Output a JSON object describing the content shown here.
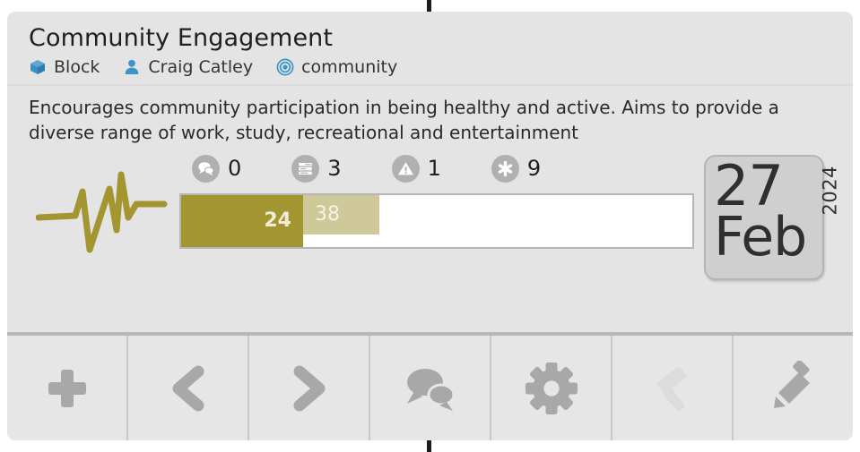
{
  "card": {
    "title": "Community Engagement",
    "meta": [
      {
        "icon": "cube-icon",
        "label": "Block"
      },
      {
        "icon": "user-icon",
        "label": "Craig Catley"
      },
      {
        "icon": "target-icon",
        "label": "community"
      }
    ],
    "description": "Encourages community participation in being healthy and active. Aims to provide a diverse range of work, study, recreational and entertainment",
    "stats": [
      {
        "icon": "comments-icon",
        "value": "0"
      },
      {
        "icon": "list-icon",
        "value": "3"
      },
      {
        "icon": "warning-icon",
        "value": "1"
      },
      {
        "icon": "asterisk-icon",
        "value": "9"
      }
    ],
    "progress": {
      "primary_value": "24",
      "secondary_value": "38"
    },
    "date": {
      "day": "27",
      "month": "Feb",
      "year": "2024"
    }
  },
  "toolbar": {
    "buttons": [
      {
        "name": "add-button",
        "icon": "plus-icon"
      },
      {
        "name": "previous-button",
        "icon": "chevron-left-icon"
      },
      {
        "name": "next-button",
        "icon": "chevron-right-icon"
      },
      {
        "name": "comments-button",
        "icon": "comments-icon"
      },
      {
        "name": "settings-button",
        "icon": "gear-icon"
      },
      {
        "name": "build-button",
        "icon": "hammer-icon"
      },
      {
        "name": "edit-button",
        "icon": "pencil-icon"
      }
    ]
  },
  "colors": {
    "accent_primary": "#a3952f",
    "accent_secondary": "#cfc898",
    "meta_icon": "#3d94c8",
    "card_background": "#e4e4e4",
    "badge_gray": "#b0b0b0"
  }
}
